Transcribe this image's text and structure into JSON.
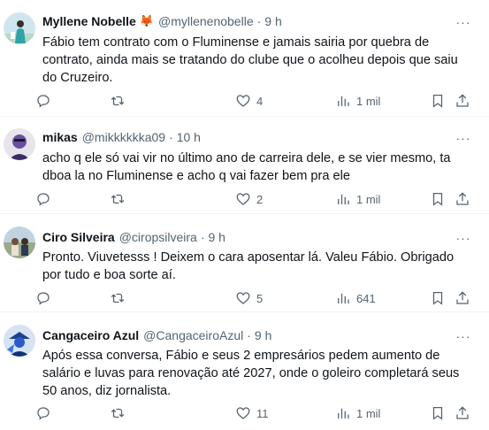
{
  "tweets": [
    {
      "name": "Myllene Nobelle",
      "emoji": "🦊",
      "handle": "@myllenenobelle",
      "time": "9 h",
      "text": "Fábio tem contrato com o Fluminense e jamais sairia por quebra de contrato, ainda mais se tratando do clube que o acolheu depois que saiu do Cruzeiro.",
      "likes": "4",
      "views": "1 mil"
    },
    {
      "name": "mikas",
      "emoji": "",
      "handle": "@mikkkkkka09",
      "time": "10 h",
      "text": "acho q ele só vai vir no último ano de carreira dele, e se vier mesmo, ta dboa la no Fluminense e acho q vai fazer bem pra ele",
      "likes": "2",
      "views": "1 mil"
    },
    {
      "name": "Ciro Silveira",
      "emoji": "",
      "handle": "@ciropsilveira",
      "time": "9 h",
      "text": "Pronto. Viuvetesss ! Deixem o cara aposentar lá. Valeu Fábio. Obrigado por tudo e boa sorte aí.",
      "likes": "5",
      "views": "641"
    },
    {
      "name": "Cangaceiro Azul",
      "emoji": "",
      "handle": "@CangaceiroAzul",
      "time": "9 h",
      "text": "Após essa conversa, Fábio e seus 2 empresários pedem aumento de salário e luvas para renovação até 2027, onde o goleiro completará seus 50 anos, diz jornalista.",
      "likes": "11",
      "views": "1 mil"
    }
  ],
  "separator": "·",
  "more_glyph": "···",
  "icons": [
    "reply-icon",
    "retweet-icon",
    "like-icon",
    "views-icon",
    "bookmark-icon",
    "share-icon",
    "more-icon"
  ],
  "colors": {
    "text": "#0f1419",
    "secondary": "#536471",
    "divider": "#eff3f4"
  }
}
